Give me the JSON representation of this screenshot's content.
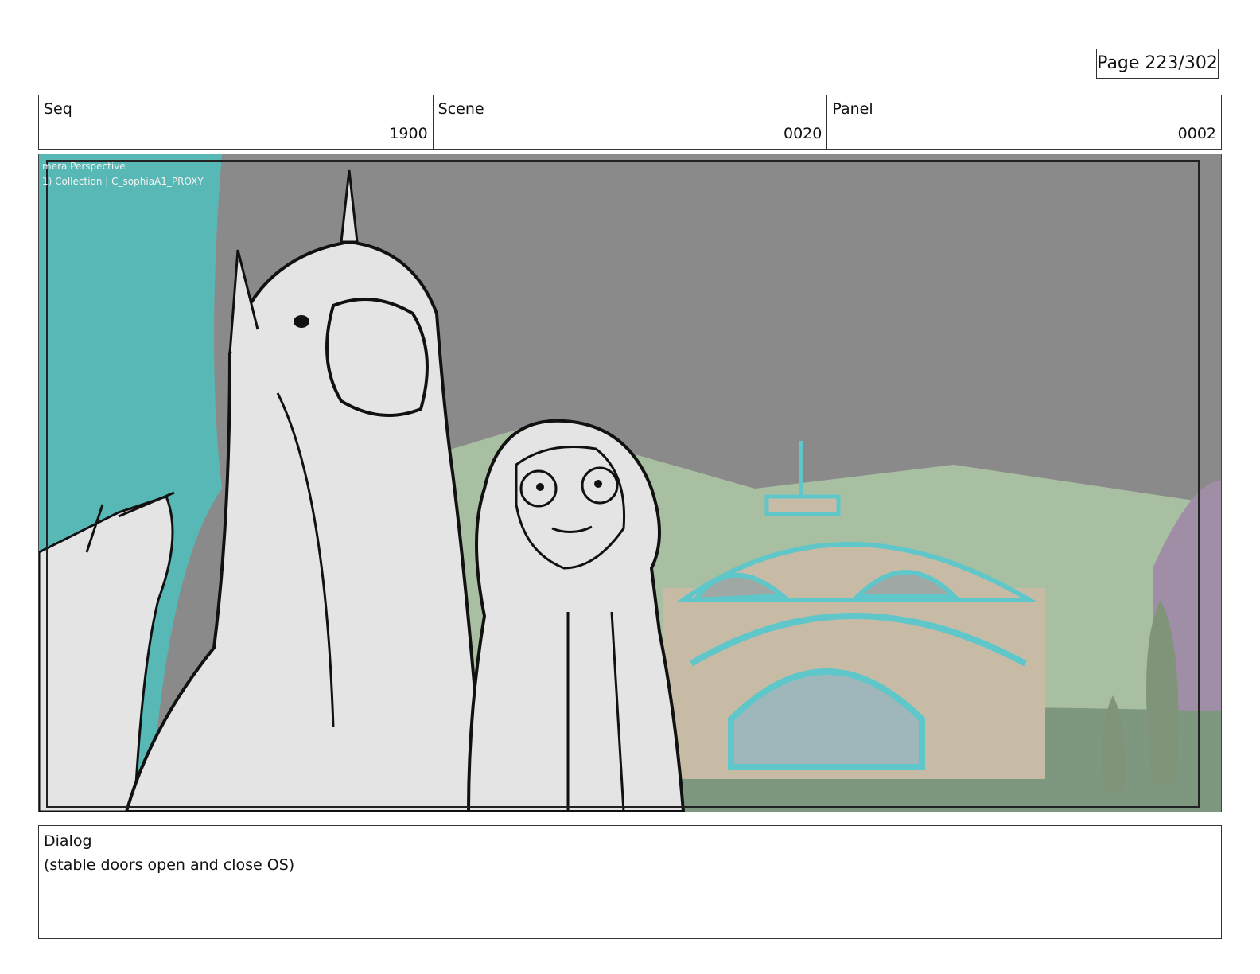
{
  "page": {
    "number_label": "Page 223/302"
  },
  "header": {
    "seq": {
      "label": "Seq",
      "value": "1900"
    },
    "scene": {
      "label": "Scene",
      "value": "0020"
    },
    "panel": {
      "label": "Panel",
      "value": "0002"
    }
  },
  "viewport": {
    "camera_label": "mera Perspective",
    "collection_label": "1) Collection | C_sophiaA1_PROXY"
  },
  "dialog": {
    "label": "Dialog",
    "text": "(stable doors open and close OS)"
  },
  "colors": {
    "sky": "#8a8a8a",
    "hills": "#a9bfa1",
    "ground": "#7e9880",
    "building": "#c8bba6",
    "trim": "#5fc7c9",
    "curtain": "#58b8b6",
    "character_fill": "#e4e4e4",
    "line": "#111111"
  }
}
